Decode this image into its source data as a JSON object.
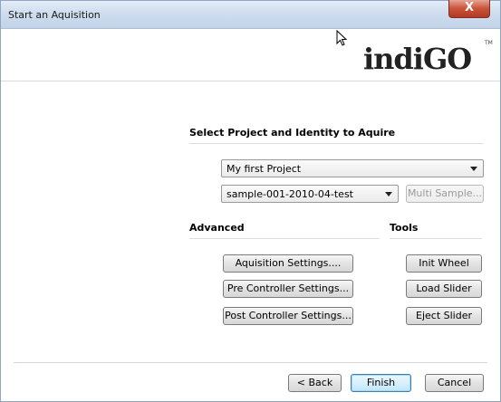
{
  "window": {
    "title": "Start an Aquisition",
    "close_glyph": "X"
  },
  "logo": {
    "text": "indiGO",
    "trademark": "TM"
  },
  "project_section": {
    "heading": "Select Project and Identity to Aquire",
    "project_select": {
      "value": "My first Project"
    },
    "identity_select": {
      "value": "sample-001-2010-04-test"
    },
    "multi_sample_label": "Multi Sample..."
  },
  "advanced": {
    "heading": "Advanced",
    "buttons": [
      "Aquisition Settings....",
      "Pre Controller Settings...",
      "Post Controller Settings..."
    ]
  },
  "tools": {
    "heading": "Tools",
    "buttons": [
      "Init Wheel",
      "Load Slider",
      "Eject Slider"
    ]
  },
  "footer": {
    "back_label": "< Back",
    "finish_label": "Finish",
    "cancel_label": "Cancel"
  },
  "colors": {
    "title_bar": "#cfddee",
    "close_button": "#c8523a",
    "default_button_border": "#3c7fb1"
  }
}
